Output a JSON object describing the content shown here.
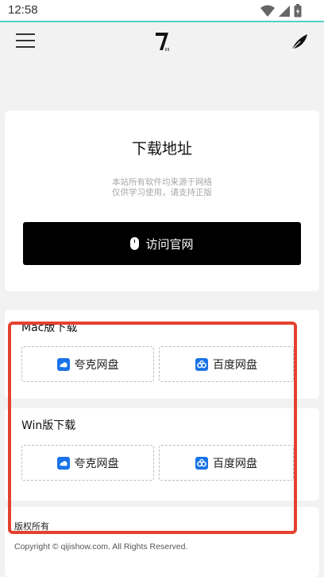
{
  "status_bar": {
    "time": "12:58"
  },
  "header": {
    "menu_icon": "hamburger-icon",
    "logo_icon": "logo-7-icon",
    "action_icon": "feather-icon"
  },
  "hero": {
    "title": "下载地址",
    "note_line1": "本站所有软件均来源于网络",
    "note_line2": "仅供学习使用，请支持正版",
    "visit_label": "访问官网"
  },
  "mac": {
    "title": "Mac版下载",
    "quark_label": "夸克网盘",
    "baidu_label": "百度网盘"
  },
  "win": {
    "title": "Win版下载",
    "quark_label": "夸克网盘",
    "baidu_label": "百度网盘"
  },
  "footer": {
    "heading": "版权所有",
    "copyright": "Copyright © qijishow.com. All Rights Reserved."
  },
  "colors": {
    "accent_highlight": "#e5412f",
    "pan_blue": "#1a73e8",
    "button_black": "#000000"
  }
}
